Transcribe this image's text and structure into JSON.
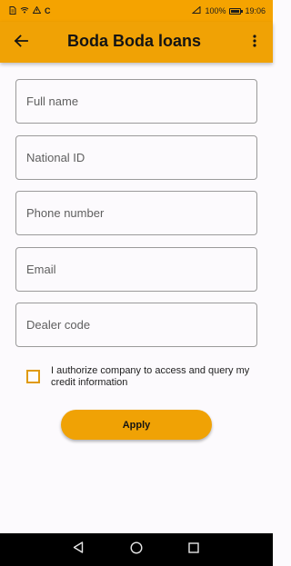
{
  "status_bar": {
    "left_icons": [
      "document-icon",
      "wifi-icon",
      "warning-icon"
    ],
    "carrier_letter": "C",
    "battery": "100%",
    "time": "19:06"
  },
  "app_bar": {
    "title": "Boda Boda loans",
    "back_icon": "arrow-left-icon",
    "menu_icon": "more-vert-icon"
  },
  "form": {
    "fields": [
      {
        "name": "full-name-input",
        "placeholder": "Full name",
        "value": ""
      },
      {
        "name": "national-id-input",
        "placeholder": "National ID",
        "value": ""
      },
      {
        "name": "phone-number-input",
        "placeholder": "Phone number",
        "value": ""
      },
      {
        "name": "email-input",
        "placeholder": "Email",
        "value": ""
      },
      {
        "name": "dealer-code-input",
        "placeholder": "Dealer code",
        "value": ""
      }
    ],
    "consent_text": "I authorize company to access and query my credit information",
    "consent_checked": false,
    "apply_label": "Apply"
  },
  "colors": {
    "accent": "#f0a205",
    "checkbox_border": "#e09a10"
  }
}
